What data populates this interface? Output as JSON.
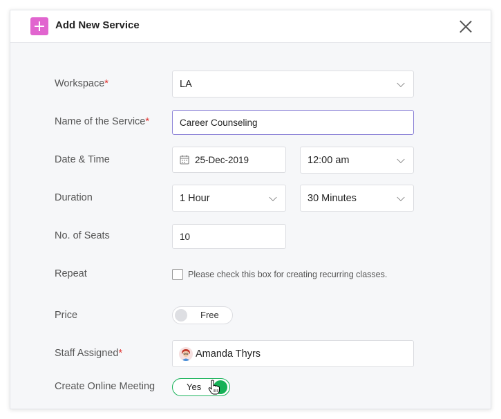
{
  "header": {
    "title": "Add New Service",
    "add_icon": "plus-icon",
    "close_icon": "close-icon"
  },
  "colors": {
    "accent_pink": "#e165cf",
    "required_star": "#e0312e",
    "toggle_green": "#16b157",
    "focus_border": "#8f86d8"
  },
  "form": {
    "required_mark": "*",
    "workspace": {
      "label": "Workspace",
      "value": "LA"
    },
    "service_name": {
      "label": "Name of the Service",
      "value": "Career Counseling"
    },
    "date_time": {
      "label": "Date & Time",
      "date": "25-Dec-2019",
      "time": "12:00 am"
    },
    "duration": {
      "label": "Duration",
      "hours": "1 Hour",
      "minutes": "30 Minutes"
    },
    "seats": {
      "label": "No. of Seats",
      "value": "10"
    },
    "repeat": {
      "label": "Repeat",
      "checkbox_text": "Please check this box for creating recurring classes."
    },
    "price": {
      "label": "Price",
      "toggle_text": "Free"
    },
    "staff": {
      "label": "Staff Assigned",
      "value": "Amanda Thyrs"
    },
    "online_meeting": {
      "label": "Create Online Meeting",
      "toggle_text": "Yes"
    }
  }
}
